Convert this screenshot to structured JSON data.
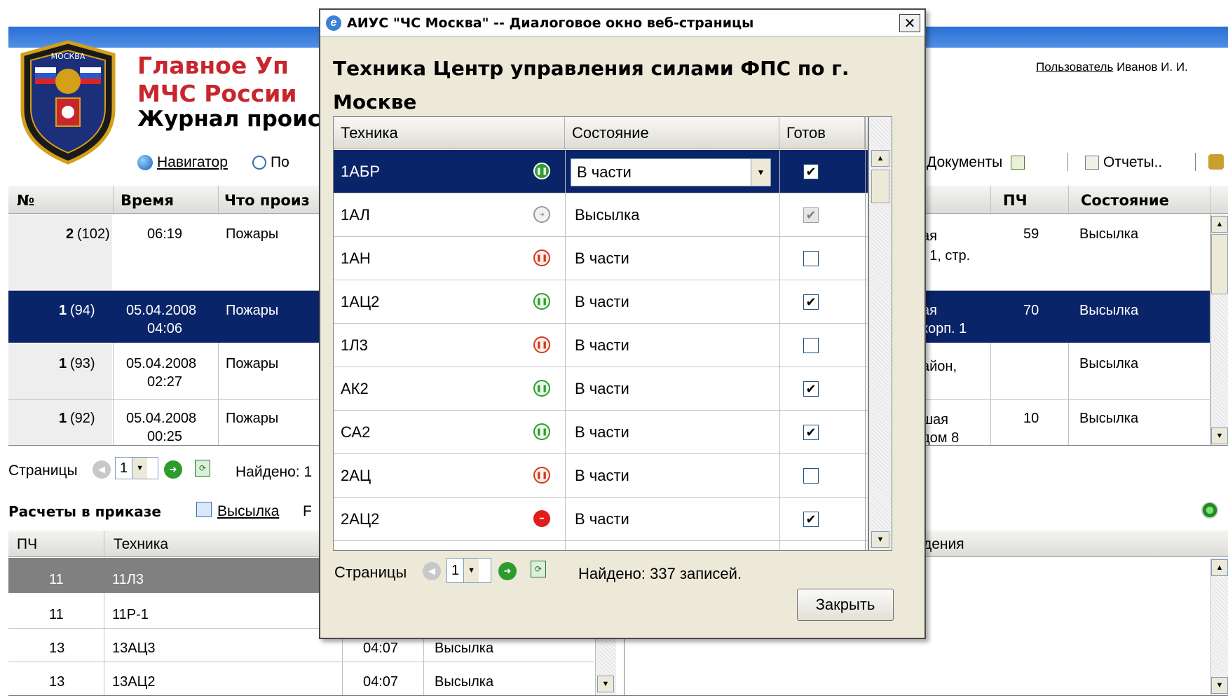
{
  "header": {
    "title_line1": "Главное Уп",
    "title_line2": "МЧС России",
    "subtitle": "Журнал проис",
    "logo_text": "МОСКВА",
    "user_label": "Пользователь",
    "user_name": "Иванов И. И."
  },
  "toolbar": {
    "navigator_label": "Навигатор",
    "search_label": "По",
    "documents_label": "Документы",
    "reports_label": "Отчеты.."
  },
  "incidents": {
    "columns": [
      "№",
      "Время",
      "Что произ",
      "ПЧ",
      "Состояние"
    ],
    "rows": [
      {
        "num": "2",
        "id": "(102)",
        "date": "",
        "time": "06:19",
        "what": "Пожары",
        "addr1": "ая",
        "addr2": ". 1, стр.",
        "pch": "59",
        "state": "Высылка"
      },
      {
        "num": "1",
        "id": "(94)",
        "date": "05.04.2008",
        "time": "04:06",
        "what": "Пожары",
        "addr1": "ая",
        "addr2": "корп. 1",
        "pch": "70",
        "state": "Высылка"
      },
      {
        "num": "1",
        "id": "(93)",
        "date": "05.04.2008",
        "time": "02:27",
        "what": "Пожары",
        "addr1": "айон,",
        "addr2": "",
        "pch": "",
        "state": "Высылка"
      },
      {
        "num": "1",
        "id": "(92)",
        "date": "05.04.2008",
        "time": "00:25",
        "what": "Пожары",
        "addr1": "шая",
        "addr2": "дом 8",
        "pch": "10",
        "state": "Высылка"
      }
    ],
    "pager": {
      "label": "Страницы",
      "page": "1",
      "found": "Найдено: 1"
    }
  },
  "orders": {
    "title": "Расчеты в приказе",
    "dispatch_label": "Высылка",
    "trailing_char": "F",
    "columns": [
      "ПЧ",
      "Техника"
    ],
    "right_column": "дения",
    "rows": [
      {
        "pch": "11",
        "tech": "11Л3",
        "time": "",
        "state": ""
      },
      {
        "pch": "11",
        "tech": "11Р-1",
        "time": "",
        "state": ""
      },
      {
        "pch": "13",
        "tech": "13АЦ3",
        "time": "04:07",
        "state": "Высылка"
      },
      {
        "pch": "13",
        "tech": "13АЦ2",
        "time": "04:07",
        "state": "Высылка"
      }
    ]
  },
  "dialog": {
    "title": "АИУС \"ЧС Москва\" -- Диалоговое окно веб-страницы",
    "heading_line1": "Техника Центр управления силами ФПС по г.",
    "heading_line2": "Москве",
    "columns": {
      "tech": "Техника",
      "state": "Состояние",
      "ready": "Готов"
    },
    "rows": [
      {
        "name": "1АБР",
        "icon": "green-filled-pause",
        "state": "В части",
        "ready": "✔"
      },
      {
        "name": "1АЛ",
        "icon": "gray-arrow",
        "state": "Высылка",
        "ready": "✔"
      },
      {
        "name": "1АН",
        "icon": "red-pause",
        "state": "В части",
        "ready": ""
      },
      {
        "name": "1АЦ2",
        "icon": "green-pause",
        "state": "В части",
        "ready": "✔"
      },
      {
        "name": "1Л3",
        "icon": "red-pause",
        "state": "В части",
        "ready": ""
      },
      {
        "name": "АК2",
        "icon": "green-pause",
        "state": "В части",
        "ready": "✔"
      },
      {
        "name": "СА2",
        "icon": "green-pause",
        "state": "В части",
        "ready": "✔"
      },
      {
        "name": "2АЦ",
        "icon": "red-pause",
        "state": "В части",
        "ready": ""
      },
      {
        "name": "2АЦ2",
        "icon": "stop",
        "state": "В части",
        "ready": "✔"
      }
    ],
    "pager": {
      "label": "Страницы",
      "page": "1",
      "found": "Найдено: 337 записей."
    },
    "close_label": "Закрыть",
    "close_glyph": "✕",
    "accent": "#0a246a"
  }
}
